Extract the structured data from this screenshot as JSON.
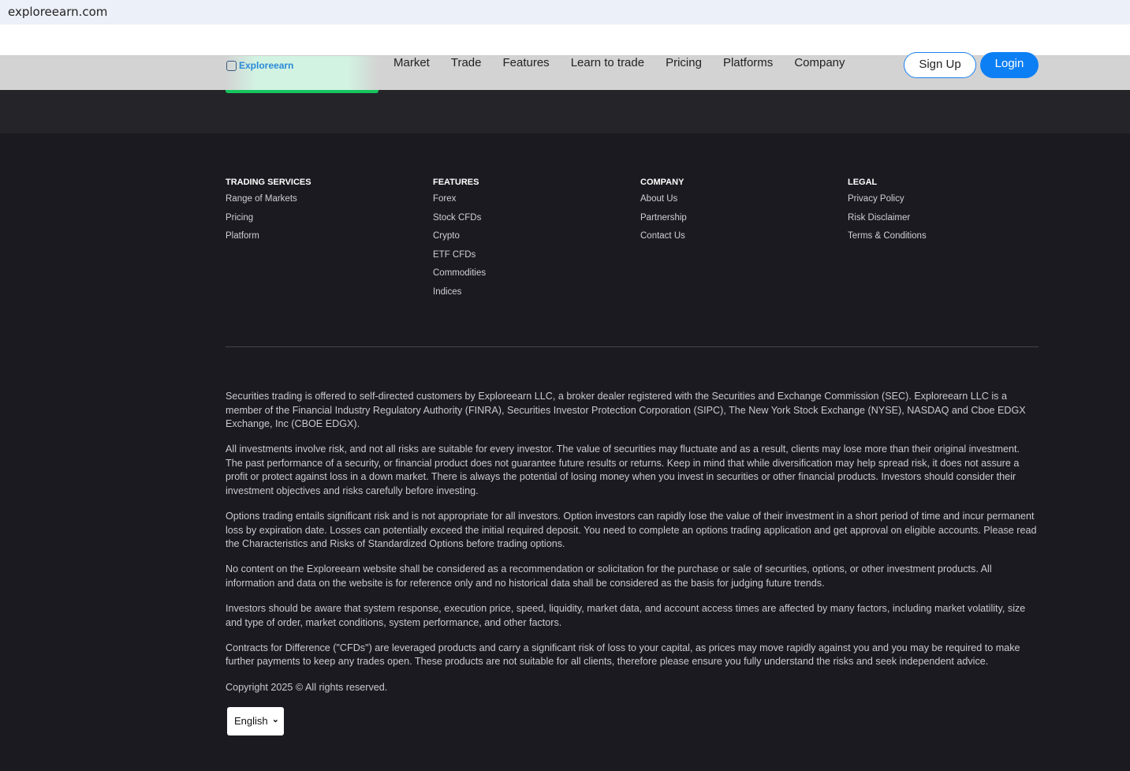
{
  "browser": {
    "url": "exploreearn.com"
  },
  "header": {
    "logo": "Exploreearn",
    "menu": [
      "Market",
      "Trade",
      "Features",
      "Learn to trade",
      "Pricing",
      "Platforms",
      "Company"
    ],
    "signup": "Sign Up",
    "login": "Login"
  },
  "footer": {
    "columns": [
      {
        "title": "TRADING SERVICES",
        "links": [
          "Range of Markets",
          "Pricing",
          "Platform"
        ]
      },
      {
        "title": "FEATURES",
        "links": [
          "Forex",
          "Stock CFDs",
          "Crypto",
          "ETF CFDs",
          "Commodities",
          "Indices"
        ]
      },
      {
        "title": "COMPANY",
        "links": [
          "About Us",
          "Partnership",
          "Contact Us"
        ]
      },
      {
        "title": "LEGAL",
        "links": [
          "Privacy Policy",
          "Risk Disclaimer",
          "Terms & Conditions"
        ]
      }
    ],
    "paragraphs": [
      "Securities trading is offered to self-directed customers by Exploreearn LLC, a broker dealer registered with the Securities and Exchange Commission (SEC). Exploreearn LLC is a member of the Financial Industry Regulatory Authority (FINRA), Securities Investor Protection Corporation (SIPC), The New York Stock Exchange (NYSE), NASDAQ and Cboe EDGX Exchange, Inc (CBOE EDGX).",
      "All investments involve risk, and not all risks are suitable for every investor. The value of securities may fluctuate and as a result, clients may lose more than their original investment. The past performance of a security, or financial product does not guarantee future results or returns. Keep in mind that while diversification may help spread risk, it does not assure a profit or protect against loss in a down market. There is always the potential of losing money when you invest in securities or other financial products. Investors should consider their investment objectives and risks carefully before investing.",
      "Options trading entails significant risk and is not appropriate for all investors. Option investors can rapidly lose the value of their investment in a short period of time and incur permanent loss by expiration date. Losses can potentially exceed the initial required deposit. You need to complete an options trading application and get approval on eligible accounts. Please read the Characteristics and Risks of Standardized Options before trading options.",
      "No content on the Exploreearn website shall be considered as a recommendation or solicitation for the purchase or sale of securities, options, or other investment products. All information and data on the website is for reference only and no historical data shall be considered as the basis for judging future trends.",
      "Investors should be aware that system response, execution price, speed, liquidity, market data, and account access times are affected by many factors, including market volatility, size and type of order, market conditions, system performance, and other factors.",
      "Contracts for Difference (\"CFDs\") are leveraged products and carry a significant risk of loss to your capital, as prices may move rapidly against you and you may be required to make further payments to keep any trades open. These products are not suitable for all clients, therefore please ensure you fully understand the risks and seek independent advice.",
      "Copyright 2025 © All rights reserved."
    ],
    "language": "English"
  }
}
